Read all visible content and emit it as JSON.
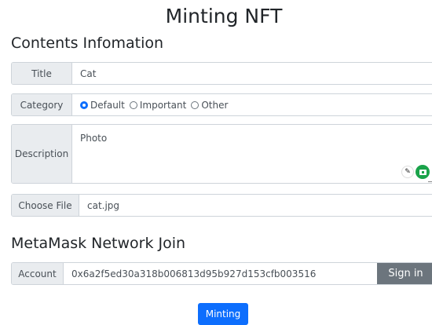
{
  "page_title": "Minting NFT",
  "contents_section": {
    "heading": "Contents Infomation",
    "title_label": "Title",
    "title_value": "Cat",
    "category_label": "Category",
    "category_options": [
      "Default",
      "Important",
      "Other"
    ],
    "category_selected": "Default",
    "description_label": "Description",
    "description_value": "Photo",
    "file_button_label": "Choose File",
    "file_name": "cat.jpg"
  },
  "metamask_section": {
    "heading": "MetaMask Network Join",
    "account_label": "Account",
    "account_value": "0x6a2f5ed30a318b006813d95b927d153cfb003516",
    "signin_label": "Sign in"
  },
  "mint_button_label": "Minting",
  "icons": {
    "grammar_pen": "pen-icon",
    "extension": "briefcase-icon"
  },
  "colors": {
    "primary": "#0d6efd",
    "secondary": "#6c757d",
    "addon_bg": "#e9ecef"
  }
}
